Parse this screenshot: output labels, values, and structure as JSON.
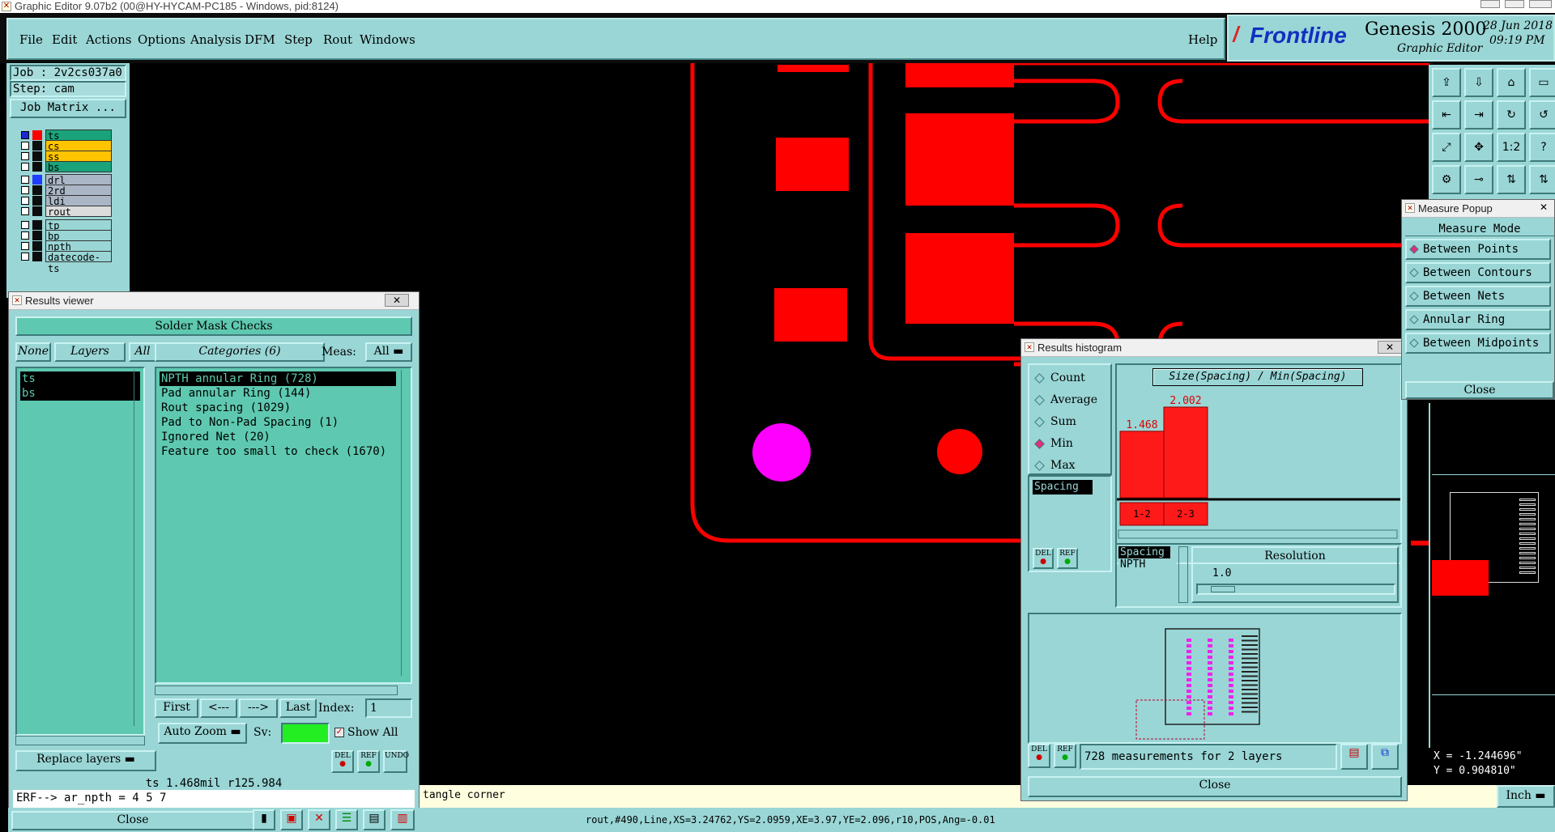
{
  "window_title": "Graphic Editor 9.07b2 (00@HY-HYCAM-PC185 - Windows, pid:8124)",
  "menu": [
    "File",
    "Edit",
    "Actions",
    "Options",
    "Analysis",
    "DFM",
    "Step",
    "Rout",
    "Windows"
  ],
  "help": "Help",
  "logo": {
    "brand": "Frontline",
    "product": "Genesis 2000",
    "subtitle": "Graphic Editor",
    "date": "28 Jun 2018",
    "time": "09:19 PM"
  },
  "job": {
    "job": "Job : 2v2cs037a0",
    "step": "Step: cam",
    "matrix_btn": "Job Matrix ..."
  },
  "layers": [
    {
      "name": "ts",
      "color": "#1aa37a",
      "swatch": "#ff0000",
      "active": true
    },
    {
      "name": "cs",
      "color": "#ffc400",
      "swatch": "#0d0d0d"
    },
    {
      "name": "ss",
      "color": "#ffc400",
      "swatch": "#0d0d0d"
    },
    {
      "name": "bs",
      "color": "#1aa37a",
      "swatch": "#0d0d0d"
    },
    {
      "name": "drl",
      "color": "#aab6c6",
      "swatch": "#1f3cff"
    },
    {
      "name": "2rd",
      "color": "#aab6c6",
      "swatch": "#0d0d0d"
    },
    {
      "name": "ldi",
      "color": "#aab6c6",
      "swatch": "#0d0d0d"
    },
    {
      "name": "rout",
      "color": "#dcdcdc",
      "swatch": "#0d0d0d"
    },
    {
      "name": "tp",
      "color": "#9ad6d6",
      "swatch": "#0d0d0d"
    },
    {
      "name": "bp",
      "color": "#9ad6d6",
      "swatch": "#0d0d0d"
    },
    {
      "name": "npth",
      "color": "#9ad6d6",
      "swatch": "#0d0d0d"
    },
    {
      "name": "datecode-ts",
      "color": "#9ad6d6",
      "swatch": "#0d0d0d"
    }
  ],
  "results_viewer": {
    "title": "Results viewer",
    "header": "Solder Mask Checks",
    "none": "None",
    "layers": "Layers",
    "all": "All",
    "categories_label": "Categories (6)",
    "meas_label": "Meas:",
    "meas_value": "All",
    "layer_items": [
      "ts",
      "bs"
    ],
    "categories": [
      "NPTH annular Ring (728)",
      "Pad annular Ring (144)",
      "Rout spacing (1029)",
      "Pad to Non-Pad Spacing (1)",
      "Ignored Net (20)",
      "Feature too small to check (1670)"
    ],
    "nav": {
      "first": "First",
      "prev": "<---",
      "next": "--->",
      "last": "Last",
      "index_label": "Index:",
      "index_value": "1"
    },
    "auto_zoom": "Auto Zoom",
    "sv_label": "Sv:",
    "show_all": "Show All",
    "replace_layers": "Replace layers",
    "del": "DEL",
    "ref": "REF",
    "undo": "UNDO",
    "status": "ts 1.468mil  r125.984",
    "erf": "ERF--> ar_npth = 4 5 7",
    "close": "Close"
  },
  "histogram": {
    "title": "Results histogram",
    "options": [
      {
        "label": "Count",
        "on": false
      },
      {
        "label": "Average",
        "on": false
      },
      {
        "label": "Sum",
        "on": false
      },
      {
        "label": "Min",
        "on": true
      },
      {
        "label": "Max",
        "on": false
      }
    ],
    "left_list": [
      "Spacing"
    ],
    "chart_title": "Size(Spacing) / Min(Spacing)",
    "chart_data": {
      "type": "bar",
      "categories": [
        "1-2",
        "2-3"
      ],
      "values": [
        1.468,
        2.002
      ],
      "title": "Size(Spacing) / Min(Spacing)"
    },
    "spacing_list": [
      "Spacing",
      "NPTH"
    ],
    "resolution_label": "Resolution",
    "resolution_value": "1.0",
    "summary": "728 measurements for 2 layers",
    "close": "Close"
  },
  "measure_popup": {
    "title": "Measure Popup",
    "mode_label": "Measure Mode",
    "items": [
      {
        "label": "Between Points",
        "on": true
      },
      {
        "label": "Between Contours",
        "on": false
      },
      {
        "label": "Between Nets",
        "on": false
      },
      {
        "label": "Annular Ring",
        "on": false
      },
      {
        "label": "Between Midpoints",
        "on": false
      }
    ],
    "close": "Close"
  },
  "tools": [
    "⇪",
    "⇩",
    "⌂",
    "▭",
    "⇤",
    "⇥",
    "↻",
    "↺",
    "⤢",
    "✥",
    "1:2",
    "?",
    "⚙",
    "⊸",
    "⇅",
    "⇅"
  ],
  "coords": {
    "x": "X = -1.244696\"",
    "y": "Y = 0.904810\""
  },
  "units": "Inch",
  "bottom_msg": "tangle corner",
  "feature_status": "rout,#490,Line,XS=3.24762,YS=2.0959,XE=3.97,YE=2.096,r10,POS,Ang=-0.01"
}
